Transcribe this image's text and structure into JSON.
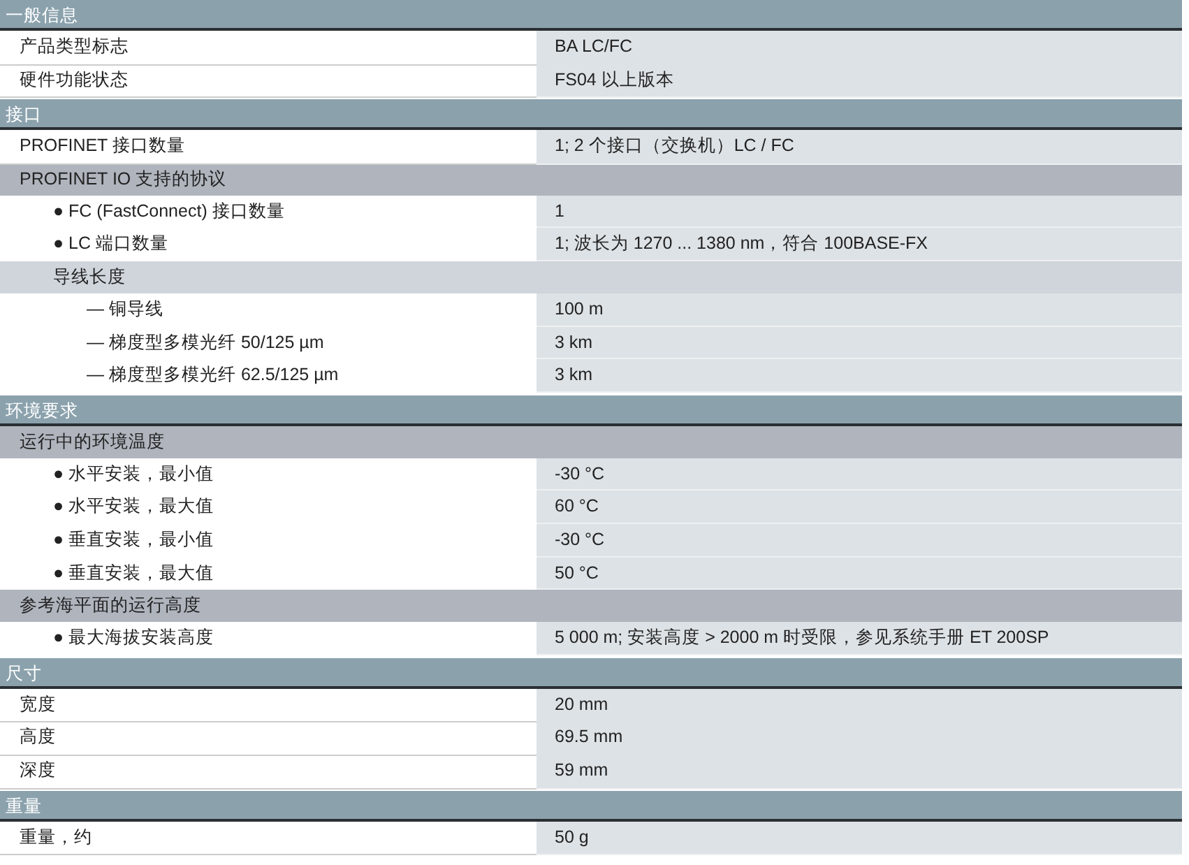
{
  "sections": [
    {
      "title": "一般信息",
      "rows": [
        {
          "kind": "item",
          "label": "产品类型标志",
          "value": "BA LC/FC"
        },
        {
          "kind": "item",
          "label": "硬件功能状态",
          "value": "FS04 以上版本"
        }
      ]
    },
    {
      "title": "接口",
      "rows": [
        {
          "kind": "item",
          "label": "PROFINET 接口数量",
          "value": "1; 2 个接口（交换机）LC / FC"
        },
        {
          "kind": "group",
          "label": "PROFINET IO 支持的协议",
          "children": [
            {
              "kind": "item",
              "label": "● FC (FastConnect) 接口数量",
              "value": "1"
            },
            {
              "kind": "item",
              "label": "● LC 端口数量",
              "value": "1; 波长为 1270 ... 1380 nm，符合 100BASE-FX"
            },
            {
              "kind": "group",
              "label": "导线长度",
              "children": [
                {
                  "kind": "item",
                  "label": "— 铜导线",
                  "value": "100 m"
                },
                {
                  "kind": "item",
                  "label": "— 梯度型多模光纤 50/125 µm",
                  "value": "3 km"
                },
                {
                  "kind": "item",
                  "label": "— 梯度型多模光纤 62.5/125 µm",
                  "value": "3 km"
                }
              ]
            }
          ]
        }
      ]
    },
    {
      "title": "环境要求",
      "rows": [
        {
          "kind": "group",
          "label": "运行中的环境温度",
          "children": [
            {
              "kind": "item",
              "label": "● 水平安装，最小值",
              "value": "-30 °C"
            },
            {
              "kind": "item",
              "label": "● 水平安装，最大值",
              "value": "60 °C"
            },
            {
              "kind": "item",
              "label": "● 垂直安装，最小值",
              "value": "-30 °C"
            },
            {
              "kind": "item",
              "label": "● 垂直安装，最大值",
              "value": "50 °C"
            }
          ]
        },
        {
          "kind": "group",
          "label": "参考海平面的运行高度",
          "children": [
            {
              "kind": "item",
              "label": "● 最大海拔安装高度",
              "value": "5 000 m; 安装高度 > 2000 m 时受限，参见系统手册 ET 200SP"
            }
          ]
        }
      ]
    },
    {
      "title": "尺寸",
      "rows": [
        {
          "kind": "item",
          "label": "宽度",
          "value": "20 mm"
        },
        {
          "kind": "item",
          "label": "高度",
          "value": "69.5 mm"
        },
        {
          "kind": "item",
          "label": "深度",
          "value": "59 mm"
        }
      ]
    },
    {
      "title": "重量",
      "rows": [
        {
          "kind": "item",
          "label": "重量，约",
          "value": "50 g"
        }
      ]
    }
  ]
}
